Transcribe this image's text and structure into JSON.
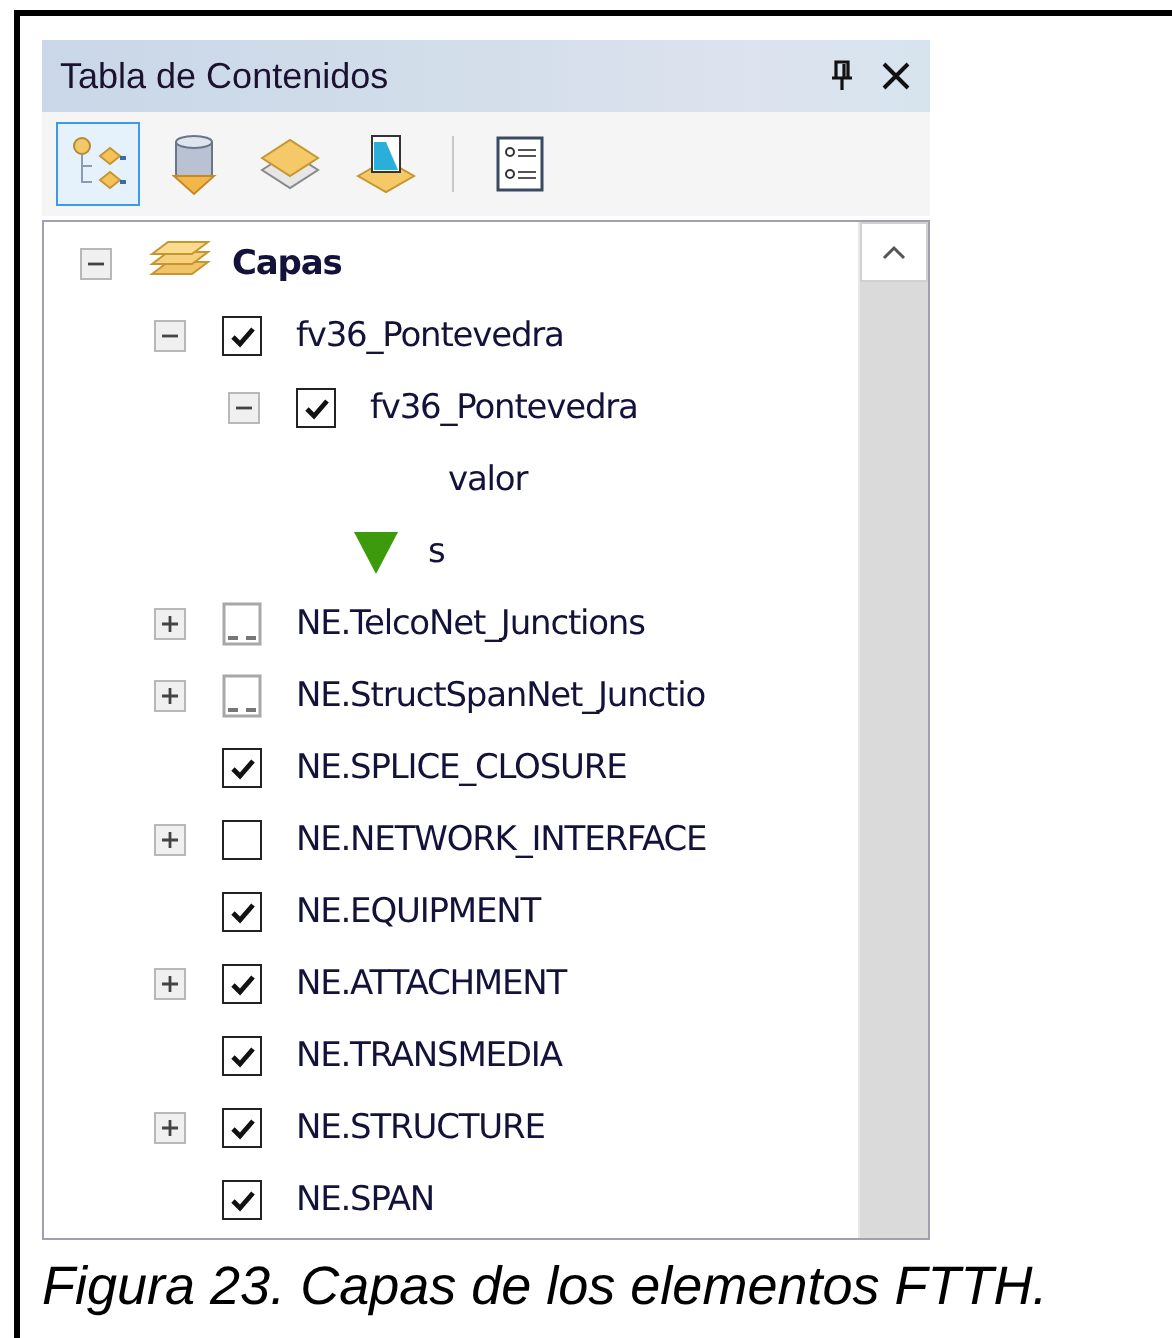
{
  "panel": {
    "title": "Tabla de Contenidos"
  },
  "toolbar": [
    {
      "selected": true
    },
    {
      "selected": false
    },
    {
      "selected": false
    },
    {
      "selected": false
    },
    {
      "selected": false
    }
  ],
  "tree": [
    {
      "kind": "group",
      "label": "Capas",
      "expanded": true,
      "children": [
        {
          "kind": "layer",
          "label": "fv36_Pontevedra",
          "checked": true,
          "expanded": true,
          "children": [
            {
              "kind": "layer",
              "label": "fv36_Pontevedra",
              "checked": true,
              "expanded": true,
              "children": [
                {
                  "kind": "legend-heading",
                  "label": "valor"
                },
                {
                  "kind": "legend-symbol",
                  "label": "s",
                  "color": "#3c9a0c"
                }
              ]
            }
          ]
        },
        {
          "kind": "network",
          "label": "NE.TelcoNet_Junctions",
          "expanded": false
        },
        {
          "kind": "network",
          "label": "NE.StructSpanNet_Junctio",
          "expanded": false
        },
        {
          "kind": "layer",
          "label": "NE.SPLICE_CLOSURE",
          "checked": true
        },
        {
          "kind": "layer",
          "label": "NE.NETWORK_INTERFACE",
          "checked": false,
          "expanded": false
        },
        {
          "kind": "layer",
          "label": "NE.EQUIPMENT",
          "checked": true
        },
        {
          "kind": "layer",
          "label": "NE.ATTACHMENT",
          "checked": true,
          "expanded": false
        },
        {
          "kind": "layer",
          "label": "NE.TRANSMEDIA",
          "checked": true
        },
        {
          "kind": "layer",
          "label": "NE.STRUCTURE",
          "checked": true,
          "expanded": false
        },
        {
          "kind": "layer",
          "label": "NE.SPAN",
          "checked": true
        }
      ]
    }
  ],
  "caption": "Figura 23. Capas de los elementos FTTH."
}
